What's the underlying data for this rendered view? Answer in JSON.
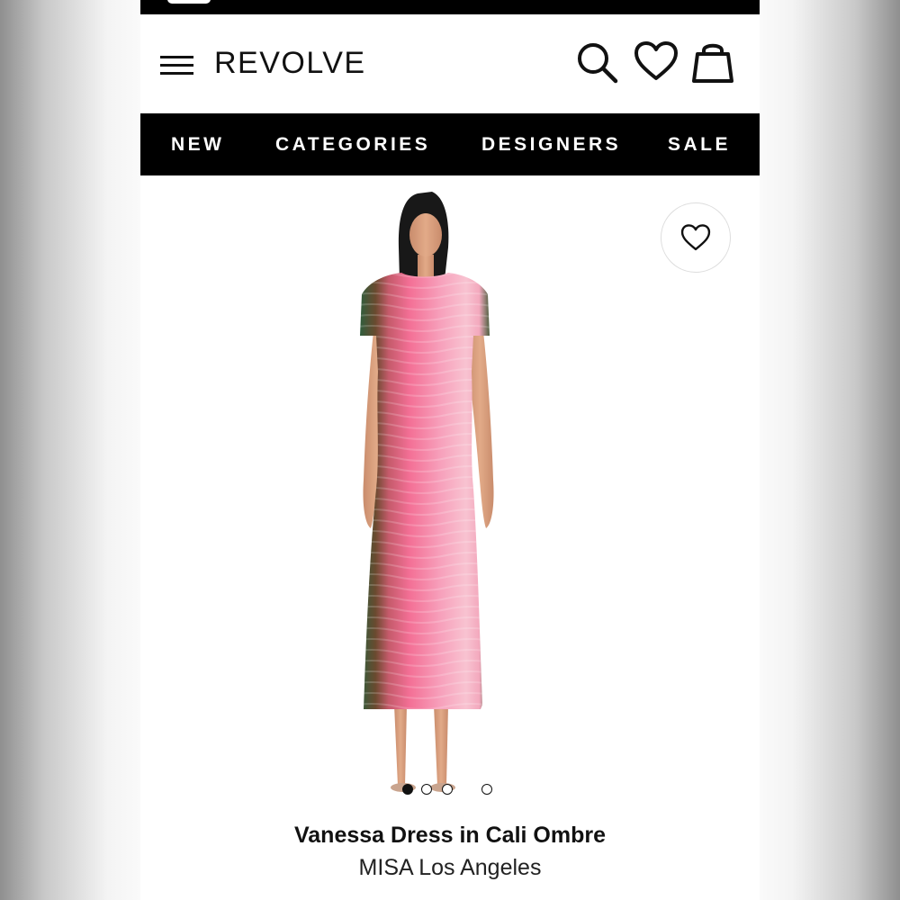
{
  "header": {
    "logo": "REVOLVE",
    "icons": [
      "menu-icon",
      "search-icon",
      "heart-icon",
      "shopping-bag-icon"
    ]
  },
  "nav": {
    "items": [
      {
        "label": "NEW"
      },
      {
        "label": "CATEGORIES"
      },
      {
        "label": "DESIGNERS"
      },
      {
        "label": "SALE"
      }
    ]
  },
  "product": {
    "image_carousel": {
      "count": 4,
      "active_index": 0
    },
    "wishlist_icon": "heart-icon",
    "name": "Vanessa Dress in Cali Ombre",
    "brand": "MISA Los Angeles"
  },
  "colors": {
    "nav_bg": "#000000",
    "text": "#111111",
    "dress_pink": "#f36f95",
    "dress_green": "#2f5d3c"
  }
}
